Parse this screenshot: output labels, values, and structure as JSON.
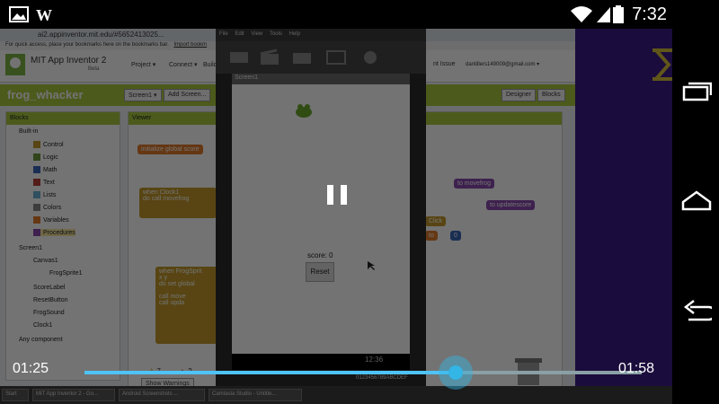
{
  "statusbar": {
    "clock": "7:32"
  },
  "browser": {
    "url": "ai2.appinventor.mit.edu/#5652413025...",
    "bookmarks_hint": "For quick access, place your bookmarks here on the bookmarks bar.",
    "import_bookmarks": "Import bookm",
    "app_name": "MIT App Inventor 2",
    "app_sub": "Beta",
    "menus": [
      "Project ▾",
      "Connect ▾",
      "Build ▾"
    ],
    "right_menu": "nt Issue",
    "user": "dantillers149009@gmail.com ▾",
    "project_title": "frog_whacker",
    "screen_btn": "Screen1 ▾",
    "add_screen_btn": "Add Screen...",
    "designer_btn": "Designer",
    "blocks_btn": "Blocks",
    "blocks_header": "Blocks",
    "viewer_header": "Viewer",
    "tree": {
      "builtin": "Built-in",
      "builtin_items": [
        "Control",
        "Logic",
        "Math",
        "Text",
        "Lists",
        "Colors",
        "Variables",
        "Procedures"
      ],
      "screen": "Screen1",
      "screen_items": [
        "Canvas1",
        "FrogSprite1",
        "ScoreLabel",
        "ResetButton",
        "FrogSound",
        "Clock1"
      ],
      "any": "Any component"
    },
    "blocks": {
      "init_global": "initialize global",
      "init_global_name": "score",
      "when_clock": "when",
      "clock_name": "Clock1",
      "do": "do",
      "call": "call",
      "movefrog": "movefrog",
      "to_movefrog": "to movefrog",
      "to_updatescore": "to updatescore",
      "click": "Click",
      "to": "to",
      "zero": "0",
      "when_frog": "when",
      "frog_name": "FrogSprit",
      "x": "x",
      "y": "y",
      "set": "set",
      "global": "global",
      "move": "move",
      "upda": "upda"
    },
    "warnings": "7",
    "errors": "2",
    "show_warnings": "Show Warnings"
  },
  "emulator": {
    "menu": [
      "File",
      "Edit",
      "View",
      "Tools",
      "Help"
    ],
    "screen_title": "Screen1",
    "score_label": "score: 0",
    "reset_button": "Reset",
    "phone_clock": "12:36",
    "device_id": "0123456789ABCDEF"
  },
  "player": {
    "current_time": "01:25",
    "total_time": "01:58",
    "progress": 0.6667
  },
  "taskbar": {
    "start": "Start",
    "tasks": [
      "MIT App Inventor 2 - Go...",
      "Android Screenshots ...",
      "Camtasia Studio - Untitle..."
    ]
  },
  "colors": {
    "progress": "#4fc3f7",
    "thumb": "#33b5e5",
    "project_bar": "#a8c83e"
  }
}
